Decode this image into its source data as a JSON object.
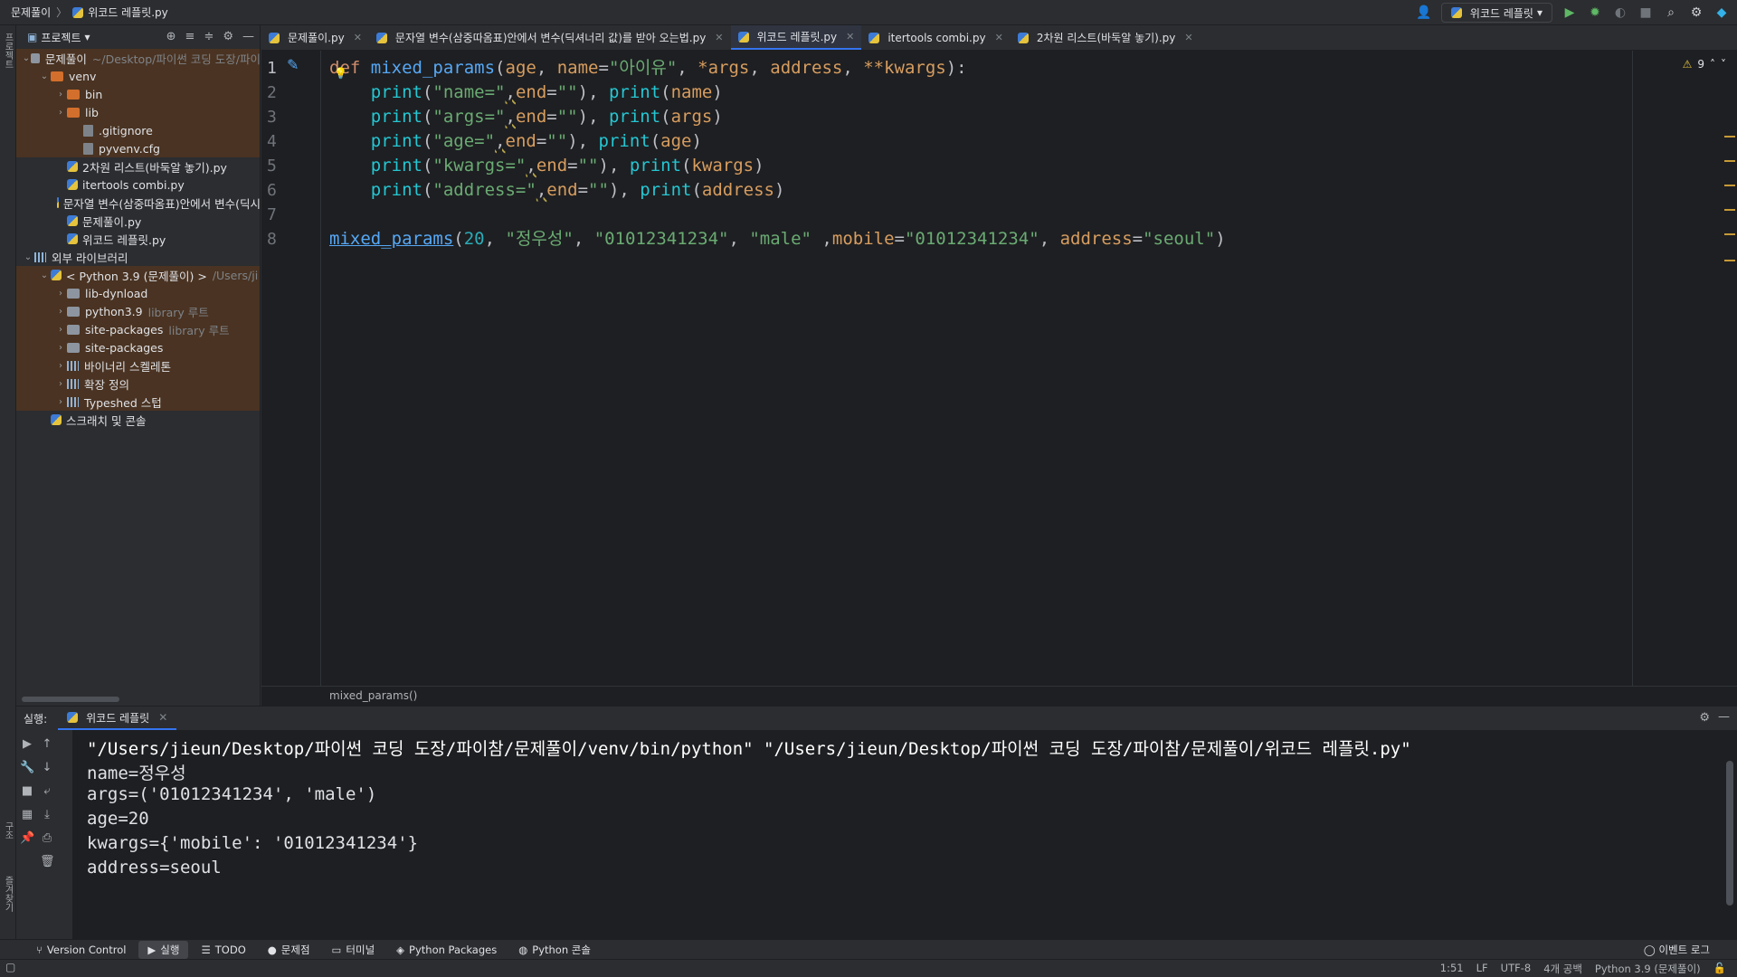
{
  "breadcrumb": [
    "문제풀이",
    "위코드 레플릿.py"
  ],
  "toolbar": {
    "run_config": "위코드 레플릿"
  },
  "left_strip": {
    "project_label": "프로젝트",
    "structure_label": "구조",
    "favorites_label": "즐겨찾기"
  },
  "project": {
    "header": "프로젝트",
    "tree": [
      {
        "label": "문제풀이",
        "note": "~/Desktop/파이썬 코딩 도장/파이",
        "indent": 0,
        "arrow": "open",
        "icon": "folder",
        "hl": true
      },
      {
        "label": "venv",
        "note": "",
        "indent": 1,
        "arrow": "open",
        "icon": "folder-orange",
        "hl": true
      },
      {
        "label": "bin",
        "note": "",
        "indent": 2,
        "arrow": "closed",
        "icon": "folder-orange",
        "hl": true
      },
      {
        "label": "lib",
        "note": "",
        "indent": 2,
        "arrow": "closed",
        "icon": "folder-orange",
        "hl": true
      },
      {
        "label": ".gitignore",
        "note": "",
        "indent": 3,
        "arrow": "",
        "icon": "file",
        "hl": true
      },
      {
        "label": "pyvenv.cfg",
        "note": "",
        "indent": 3,
        "arrow": "",
        "icon": "file",
        "hl": true
      },
      {
        "label": "2차원 리스트(바둑알 놓기).py",
        "note": "",
        "indent": 2,
        "arrow": "",
        "icon": "py",
        "hl": false
      },
      {
        "label": "itertools combi.py",
        "note": "",
        "indent": 2,
        "arrow": "",
        "icon": "py",
        "hl": false
      },
      {
        "label": "문자열 변수(삼중따옴표)안에서 변수(딕시",
        "note": "",
        "indent": 2,
        "arrow": "",
        "icon": "py",
        "hl": false
      },
      {
        "label": "문제풀이.py",
        "note": "",
        "indent": 2,
        "arrow": "",
        "icon": "py",
        "hl": false
      },
      {
        "label": "위코드 레플릿.py",
        "note": "",
        "indent": 2,
        "arrow": "",
        "icon": "py",
        "hl": false
      },
      {
        "label": "외부 라이브러리",
        "note": "",
        "indent": 0,
        "arrow": "open",
        "icon": "lib",
        "hl": false
      },
      {
        "label": "< Python 3.9 (문제풀이) >",
        "note": "/Users/ji",
        "indent": 1,
        "arrow": "open",
        "icon": "py",
        "hl": true
      },
      {
        "label": "lib-dynload",
        "note": "",
        "indent": 2,
        "arrow": "closed",
        "icon": "folder",
        "hl": true
      },
      {
        "label": "python3.9",
        "note": "library 루트",
        "indent": 2,
        "arrow": "closed",
        "icon": "folder",
        "hl": true
      },
      {
        "label": "site-packages",
        "note": "library 루트",
        "indent": 2,
        "arrow": "closed",
        "icon": "folder",
        "hl": true
      },
      {
        "label": "site-packages",
        "note": "",
        "indent": 2,
        "arrow": "closed",
        "icon": "folder",
        "hl": true
      },
      {
        "label": "바이너리 스켈레톤",
        "note": "",
        "indent": 2,
        "arrow": "closed",
        "icon": "lib",
        "hl": true
      },
      {
        "label": "확장 정의",
        "note": "",
        "indent": 2,
        "arrow": "closed",
        "icon": "lib",
        "hl": true
      },
      {
        "label": "Typeshed 스텁",
        "note": "",
        "indent": 2,
        "arrow": "closed",
        "icon": "lib",
        "hl": true
      },
      {
        "label": "스크래치 및 콘솔",
        "note": "",
        "indent": 1,
        "arrow": "",
        "icon": "scratch",
        "hl": false
      }
    ]
  },
  "tabs": [
    {
      "label": "문제풀이.py",
      "active": false
    },
    {
      "label": "문자열 변수(삼중따옴표)안에서 변수(딕셔너리 값)를 받아 오는법.py",
      "active": false
    },
    {
      "label": "위코드 레플릿.py",
      "active": true
    },
    {
      "label": "itertools combi.py",
      "active": false
    },
    {
      "label": "2차원 리스트(바둑알 놓기).py",
      "active": false
    }
  ],
  "editor": {
    "warning_count": "9",
    "line_numbers": [
      "1",
      "2",
      "3",
      "4",
      "5",
      "6",
      "7",
      "8"
    ],
    "lines": [
      [
        {
          "t": "def ",
          "c": "kw"
        },
        {
          "t": "mixed_params",
          "c": "fn"
        },
        {
          "t": "(",
          "c": "op"
        },
        {
          "t": "age",
          "c": "param"
        },
        {
          "t": ", ",
          "c": "op"
        },
        {
          "t": "name",
          "c": "param"
        },
        {
          "t": "=",
          "c": "op"
        },
        {
          "t": "\"아이유\"",
          "c": "str"
        },
        {
          "t": ", ",
          "c": "op"
        },
        {
          "t": "*args",
          "c": "param"
        },
        {
          "t": ", ",
          "c": "op"
        },
        {
          "t": "address",
          "c": "param"
        },
        {
          "t": ", ",
          "c": "op"
        },
        {
          "t": "**kwargs",
          "c": "param"
        },
        {
          "t": "):",
          "c": "op"
        }
      ],
      [
        {
          "t": "    ",
          "c": "op"
        },
        {
          "t": "print",
          "c": "bi2"
        },
        {
          "t": "(",
          "c": "op"
        },
        {
          "t": "\"name=\"",
          "c": "str"
        },
        {
          "t": ",",
          "c": "wavy"
        },
        {
          "t": "end",
          "c": "param"
        },
        {
          "t": "=",
          "c": "op"
        },
        {
          "t": "\"\"",
          "c": "str"
        },
        {
          "t": "), ",
          "c": "op"
        },
        {
          "t": "print",
          "c": "bi2"
        },
        {
          "t": "(",
          "c": "op"
        },
        {
          "t": "name",
          "c": "param"
        },
        {
          "t": ")",
          "c": "op"
        }
      ],
      [
        {
          "t": "    ",
          "c": "op"
        },
        {
          "t": "print",
          "c": "bi2"
        },
        {
          "t": "(",
          "c": "op"
        },
        {
          "t": "\"args=\"",
          "c": "str"
        },
        {
          "t": ",",
          "c": "wavy"
        },
        {
          "t": "end",
          "c": "param"
        },
        {
          "t": "=",
          "c": "op"
        },
        {
          "t": "\"\"",
          "c": "str"
        },
        {
          "t": "), ",
          "c": "op"
        },
        {
          "t": "print",
          "c": "bi2"
        },
        {
          "t": "(",
          "c": "op"
        },
        {
          "t": "args",
          "c": "param"
        },
        {
          "t": ")",
          "c": "op"
        }
      ],
      [
        {
          "t": "    ",
          "c": "op"
        },
        {
          "t": "print",
          "c": "bi2"
        },
        {
          "t": "(",
          "c": "op"
        },
        {
          "t": "\"age=\"",
          "c": "str"
        },
        {
          "t": ",",
          "c": "wavy"
        },
        {
          "t": "end",
          "c": "param"
        },
        {
          "t": "=",
          "c": "op"
        },
        {
          "t": "\"\"",
          "c": "str"
        },
        {
          "t": "), ",
          "c": "op"
        },
        {
          "t": "print",
          "c": "bi2"
        },
        {
          "t": "(",
          "c": "op"
        },
        {
          "t": "age",
          "c": "param"
        },
        {
          "t": ")",
          "c": "op"
        }
      ],
      [
        {
          "t": "    ",
          "c": "op"
        },
        {
          "t": "print",
          "c": "bi2"
        },
        {
          "t": "(",
          "c": "op"
        },
        {
          "t": "\"kwargs=\"",
          "c": "str"
        },
        {
          "t": ",",
          "c": "wavy"
        },
        {
          "t": "end",
          "c": "param"
        },
        {
          "t": "=",
          "c": "op"
        },
        {
          "t": "\"\"",
          "c": "str"
        },
        {
          "t": "), ",
          "c": "op"
        },
        {
          "t": "print",
          "c": "bi2"
        },
        {
          "t": "(",
          "c": "op"
        },
        {
          "t": "kwargs",
          "c": "param"
        },
        {
          "t": ")",
          "c": "op"
        }
      ],
      [
        {
          "t": "    ",
          "c": "op"
        },
        {
          "t": "print",
          "c": "bi2"
        },
        {
          "t": "(",
          "c": "op"
        },
        {
          "t": "\"address=\"",
          "c": "str"
        },
        {
          "t": ",",
          "c": "wavy"
        },
        {
          "t": "end",
          "c": "param"
        },
        {
          "t": "=",
          "c": "op"
        },
        {
          "t": "\"\"",
          "c": "str"
        },
        {
          "t": "), ",
          "c": "op"
        },
        {
          "t": "print",
          "c": "bi2"
        },
        {
          "t": "(",
          "c": "op"
        },
        {
          "t": "address",
          "c": "param"
        },
        {
          "t": ")",
          "c": "op"
        }
      ],
      [],
      [
        {
          "t": "mixed_params",
          "c": "call"
        },
        {
          "t": "(",
          "c": "op"
        },
        {
          "t": "20",
          "c": "num"
        },
        {
          "t": ", ",
          "c": "op"
        },
        {
          "t": "\"정우성\"",
          "c": "str"
        },
        {
          "t": ", ",
          "c": "op"
        },
        {
          "t": "\"01012341234\"",
          "c": "str"
        },
        {
          "t": ", ",
          "c": "op"
        },
        {
          "t": "\"male\"",
          "c": "str"
        },
        {
          "t": " ,",
          "c": "op"
        },
        {
          "t": "mobile",
          "c": "param"
        },
        {
          "t": "=",
          "c": "op"
        },
        {
          "t": "\"01012341234\"",
          "c": "str"
        },
        {
          "t": ", ",
          "c": "op"
        },
        {
          "t": "address",
          "c": "param"
        },
        {
          "t": "=",
          "c": "op"
        },
        {
          "t": "\"seoul\"",
          "c": "str"
        },
        {
          "t": ")",
          "c": "op"
        }
      ]
    ],
    "footer_crumb": "mixed_params()"
  },
  "run": {
    "label": "실행:",
    "tab": "위코드 레플릿",
    "output": [
      "\"/Users/jieun/Desktop/파이썬 코딩 도장/파이참/문제풀이/venv/bin/python\" \"/Users/jieun/Desktop/파이썬 코딩 도장/파이참/문제풀이/위코드 레플릿.py\"",
      "name=정우성",
      "args=('01012341234', 'male')",
      "age=20",
      "kwargs={'mobile': '01012341234'}",
      "address=seoul"
    ]
  },
  "bottom_tools": [
    "Version Control",
    "실행",
    "TODO",
    "문제점",
    "터미널",
    "Python Packages",
    "Python 콘솔"
  ],
  "event_log": "이벤트 로그",
  "status": [
    "1:51",
    "LF",
    "UTF-8",
    "4개 공백",
    "Python 3.9 (문제풀이)"
  ],
  "colors": {
    "accent": "#3574f0",
    "highlight_row": "#4a3322",
    "editor_bg": "#1e1f22"
  }
}
